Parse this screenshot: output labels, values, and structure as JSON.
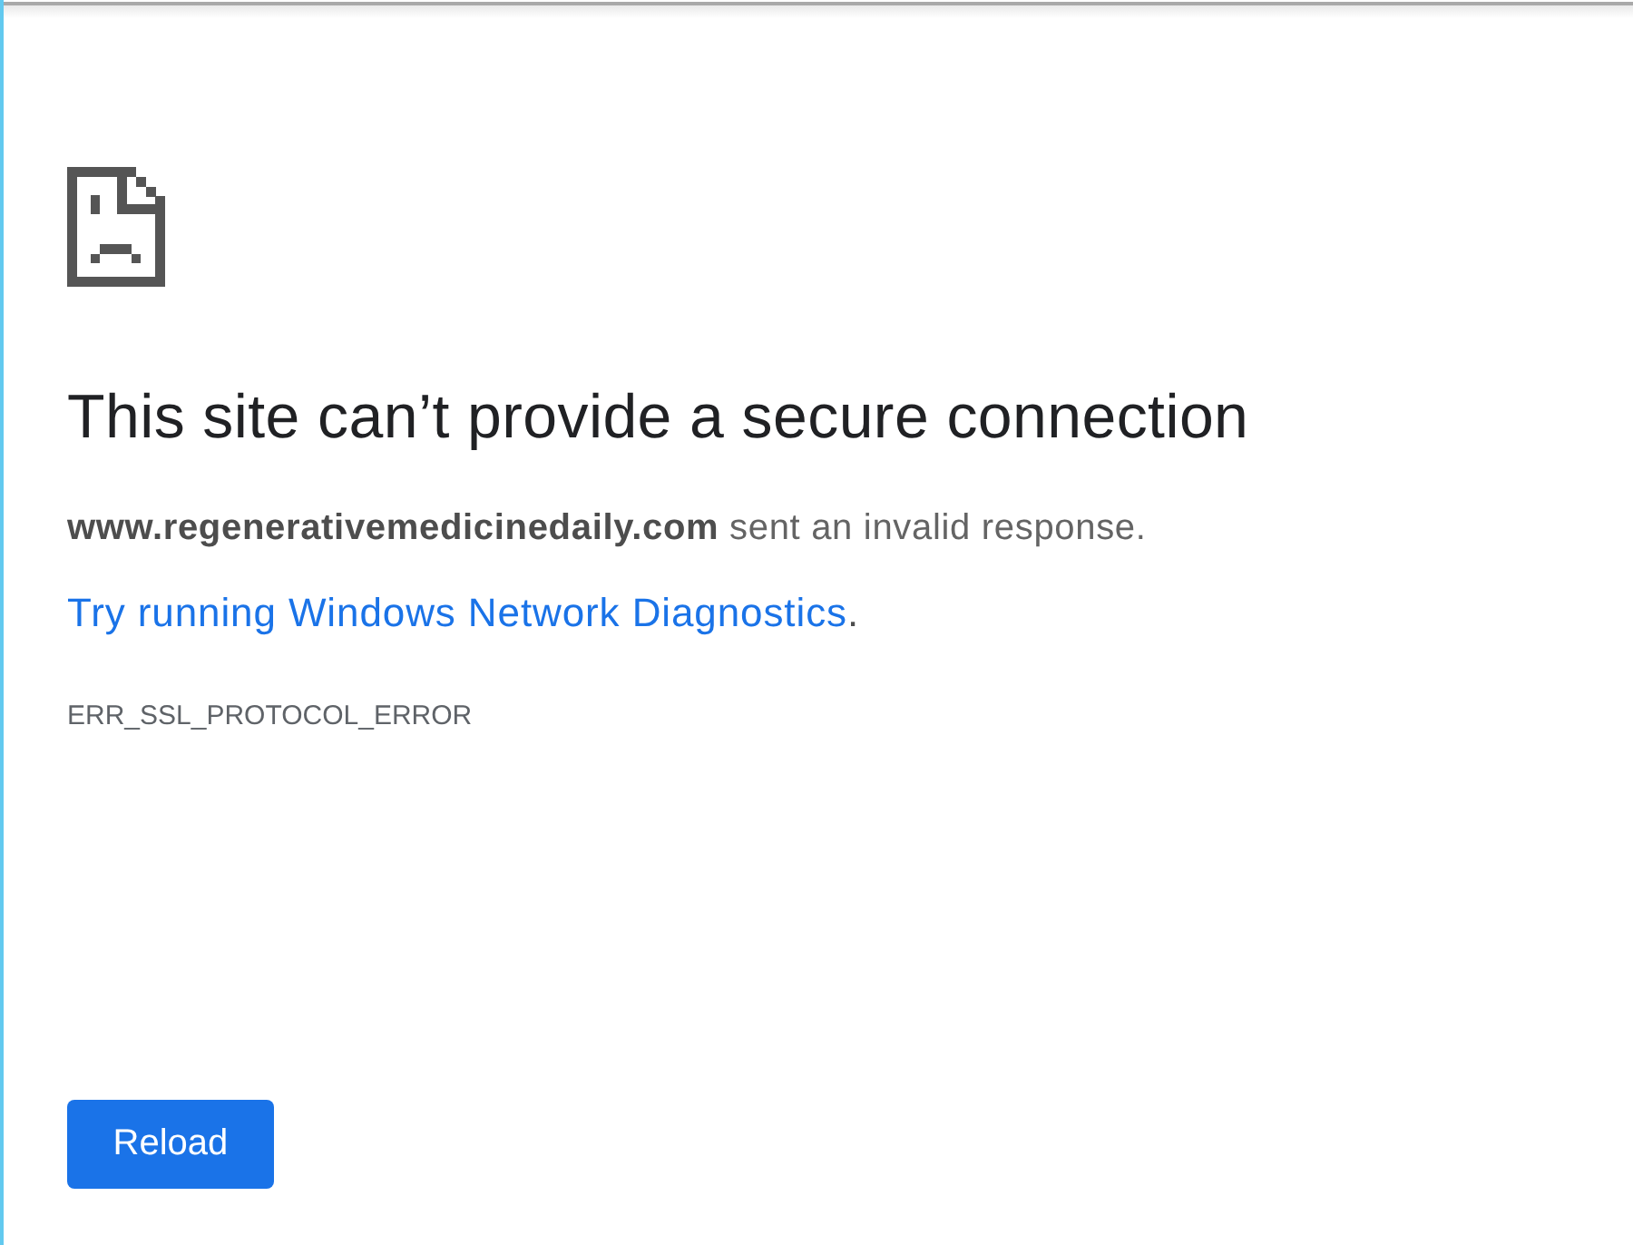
{
  "heading": "This site can’t provide a secure connection",
  "message": "**www.regenerativemedicinedaily.com** sent an invalid response.",
  "suggestion": {
    "link": "Try running Windows Network Diagnostics",
    "suffix": "."
  },
  "error_code": "ERR_SSL_PROTOCOL_ERROR",
  "buttons": [
    {
      "label": "Reload"
    }
  ]
}
